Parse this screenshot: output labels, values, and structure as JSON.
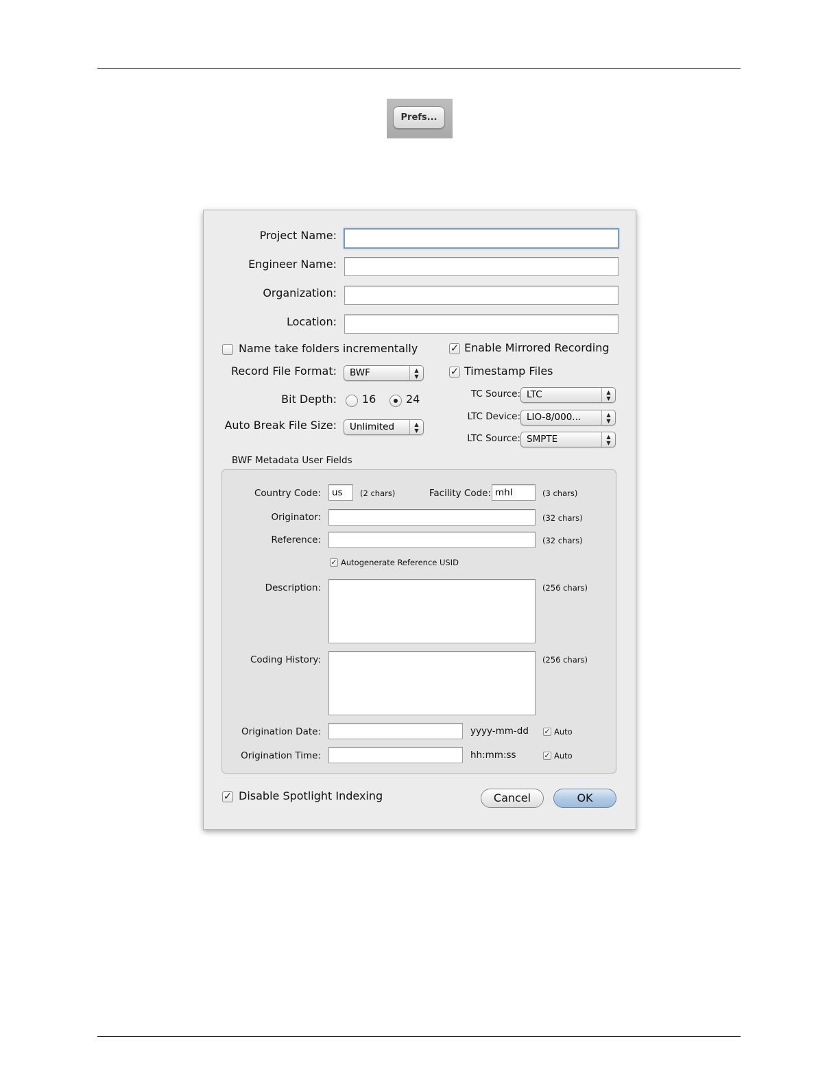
{
  "prefs_button": {
    "label": "Prefs..."
  },
  "dialog": {
    "fields": {
      "project_name": {
        "label": "Project Name:",
        "value": ""
      },
      "engineer_name": {
        "label": "Engineer Name:",
        "value": ""
      },
      "organization": {
        "label": "Organization:",
        "value": ""
      },
      "location": {
        "label": "Location:",
        "value": ""
      }
    },
    "name_take_folders": {
      "label": "Name take folders incrementally",
      "checked": false
    },
    "enable_mirrored": {
      "label": "Enable Mirrored Recording",
      "checked": true
    },
    "record_file_format": {
      "label": "Record File Format:",
      "value": "BWF"
    },
    "timestamp_files": {
      "label": "Timestamp Files",
      "checked": true
    },
    "bit_depth": {
      "label": "Bit Depth:",
      "options": [
        "16",
        "24"
      ],
      "selected": "24"
    },
    "tc_source": {
      "label": "TC Source:",
      "value": "LTC"
    },
    "ltc_device": {
      "label": "LTC Device:",
      "value": "LIO-8/000..."
    },
    "auto_break": {
      "label": "Auto Break File Size:",
      "value": "Unlimited"
    },
    "ltc_source": {
      "label": "LTC Source:",
      "value": "SMPTE"
    },
    "bwf": {
      "title": "BWF Metadata User Fields",
      "country_code": {
        "label": "Country Code:",
        "value": "us",
        "hint": "(2 chars)"
      },
      "facility_code": {
        "label": "Facility Code:",
        "value": "mhl",
        "hint": "(3 chars)"
      },
      "originator": {
        "label": "Originator:",
        "value": "",
        "hint": "(32 chars)"
      },
      "reference": {
        "label": "Reference:",
        "value": "",
        "hint": "(32 chars)"
      },
      "autogenerate": {
        "label": "Autogenerate Reference USID",
        "checked": true
      },
      "description": {
        "label": "Description:",
        "hint": "(256 chars)"
      },
      "coding_history": {
        "label": "Coding History:",
        "hint": "(256 chars)"
      },
      "origination_date": {
        "label": "Origination Date:",
        "value": "",
        "format": "yyyy-mm-dd",
        "auto_label": "Auto",
        "auto_checked": true
      },
      "origination_time": {
        "label": "Origination Time:",
        "value": "",
        "format": "hh:mm:ss",
        "auto_label": "Auto",
        "auto_checked": true
      }
    },
    "disable_spotlight": {
      "label": "Disable Spotlight Indexing",
      "checked": true
    },
    "cancel_label": "Cancel",
    "ok_label": "OK"
  }
}
